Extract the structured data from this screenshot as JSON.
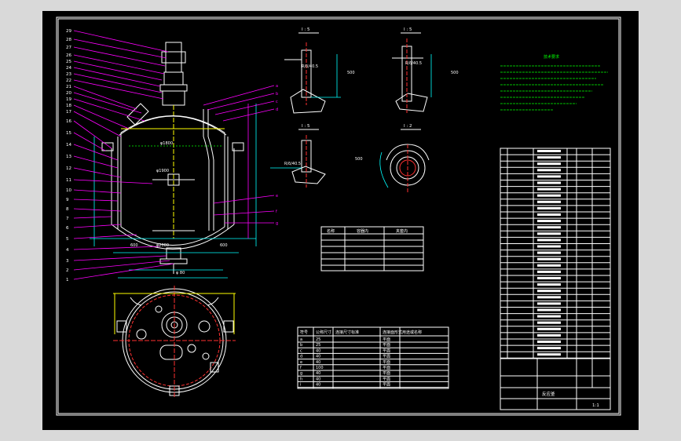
{
  "drawing": {
    "background": "#000000",
    "frame_color": "#ffffff",
    "section_labels": [
      "I : 5",
      "I : 5",
      "I : 5",
      "I : 2"
    ],
    "dim_labels": [
      "φ1800",
      "φ1900",
      "φ2000",
      "600",
      "600",
      "φ 80",
      "R/δ/40.5",
      "R/δ/40.5",
      "R/δ/40.5",
      "500",
      "500",
      "500"
    ],
    "leader_numbers": [
      "29",
      "28",
      "27",
      "26",
      "25",
      "24",
      "23",
      "22",
      "21",
      "20",
      "19",
      "18",
      "17",
      "16",
      "15",
      "14",
      "13",
      "12",
      "11",
      "10",
      "9",
      "8",
      "7",
      "6",
      "5",
      "4",
      "3",
      "2",
      "1"
    ],
    "right_leader_numbers": [
      "a",
      "b",
      "c",
      "d",
      "e",
      "f",
      "g"
    ],
    "tech_req_title": "技术要求",
    "nozzle_table": {
      "headers": [
        "符号",
        "公称尺寸",
        "连接尺寸标准",
        "连接面形式",
        "用途或名称"
      ],
      "rows": [
        [
          "a",
          "25",
          "",
          "平面",
          ""
        ],
        [
          "b",
          "25",
          "",
          "平面",
          ""
        ],
        [
          "c",
          "40",
          "",
          "平面",
          ""
        ],
        [
          "d",
          "40",
          "",
          "平面",
          ""
        ],
        [
          "e",
          "40",
          "",
          "平面",
          ""
        ],
        [
          "f",
          "100",
          "",
          "平面",
          ""
        ],
        [
          "g",
          "40",
          "",
          "平面",
          ""
        ],
        [
          "h",
          "40",
          "",
          "平面",
          ""
        ],
        [
          "i",
          "40",
          "",
          "平面",
          ""
        ]
      ]
    },
    "design_table": {
      "headers": [
        "名称",
        "容器内",
        "夹套内"
      ]
    },
    "title_block": {
      "drawing_title": "反应釜",
      "scale": "1:1"
    }
  }
}
